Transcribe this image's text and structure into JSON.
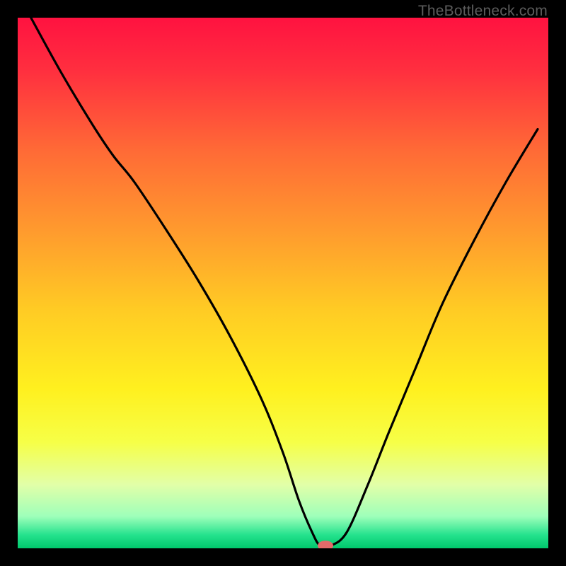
{
  "watermark": "TheBottleneck.com",
  "chart_data": {
    "type": "line",
    "title": "",
    "xlabel": "",
    "ylabel": "",
    "xlim": [
      0,
      100
    ],
    "ylim": [
      0,
      100
    ],
    "grid": false,
    "legend": false,
    "background_gradient": {
      "stops": [
        {
          "offset": 0.0,
          "color": "#ff1240"
        },
        {
          "offset": 0.1,
          "color": "#ff2f3f"
        },
        {
          "offset": 0.25,
          "color": "#ff6a36"
        },
        {
          "offset": 0.4,
          "color": "#ff9a2e"
        },
        {
          "offset": 0.55,
          "color": "#ffcb24"
        },
        {
          "offset": 0.7,
          "color": "#fff01f"
        },
        {
          "offset": 0.8,
          "color": "#f6ff47"
        },
        {
          "offset": 0.88,
          "color": "#e2ffa8"
        },
        {
          "offset": 0.94,
          "color": "#9effba"
        },
        {
          "offset": 0.975,
          "color": "#24e28d"
        },
        {
          "offset": 1.0,
          "color": "#00c86c"
        }
      ]
    },
    "series": [
      {
        "name": "bottleneck-curve",
        "color": "#000000",
        "x": [
          2.5,
          8,
          14,
          18,
          22,
          28,
          34,
          40,
          46,
          50,
          53,
          55.5,
          57,
          59,
          62,
          66,
          70,
          75,
          80,
          86,
          92,
          98
        ],
        "y": [
          100,
          90,
          80,
          74,
          69,
          60,
          50.5,
          40,
          28,
          18,
          9,
          3,
          0.5,
          0.5,
          3,
          12,
          22,
          34,
          46,
          58,
          69,
          79
        ]
      }
    ],
    "marker": {
      "name": "optimal-point",
      "x": 58,
      "y": 0.5,
      "color": "#e46a6a",
      "rx": 11,
      "ry": 7
    }
  }
}
